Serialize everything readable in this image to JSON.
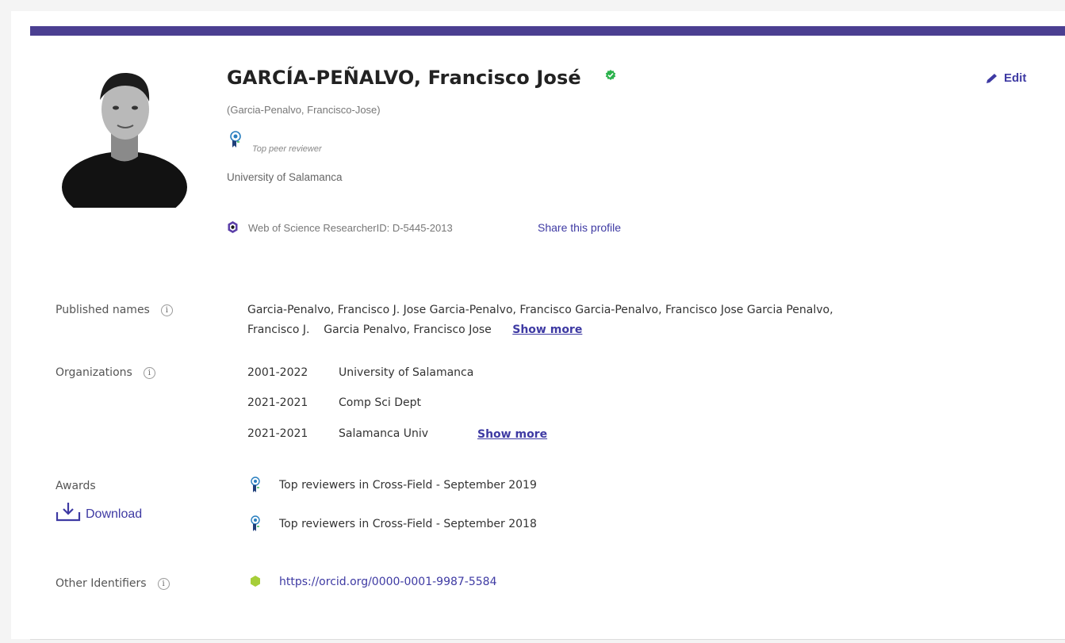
{
  "profile": {
    "name": "GARCÍA-PEÑALVO, Francisco José",
    "alt_name": "(Garcia-Penalvo, Francisco-Jose)",
    "badge_text": "Top peer reviewer",
    "affiliation": "University of Salamanca",
    "researcher_id_text": "Web of Science ResearcherID: D-5445-2013",
    "share_label": "Share this profile",
    "edit_label": "Edit"
  },
  "published_names": {
    "label": "Published names",
    "line1": "Garcia-Penalvo, Francisco J.    Jose Garcia-Penalvo, Francisco     Garcia-Penalvo, Francisco Jose     Garcia Penalvo,",
    "line2": "Francisco J.    Garcia Penalvo, Francisco Jose",
    "show_more": "Show more"
  },
  "organizations": {
    "label": "Organizations",
    "items": [
      {
        "years": "2001-2022",
        "name": "University of Salamanca"
      },
      {
        "years": "2021-2021",
        "name": "Comp Sci Dept"
      },
      {
        "years": "2021-2021",
        "name": "Salamanca Univ"
      }
    ],
    "show_more": "Show more"
  },
  "awards": {
    "label": "Awards",
    "download_label": "Download",
    "items": [
      "Top reviewers in Cross-Field - September 2019",
      "Top reviewers in Cross-Field - September 2018"
    ]
  },
  "other_identifiers": {
    "label": "Other Identifiers",
    "orcid": "https://orcid.org/0000-0001-9987-5584"
  },
  "colors": {
    "accent": "#4b3f91",
    "link": "#3e3aa3",
    "verified": "#2bb24c"
  },
  "icons": {
    "verified": "check-badge-icon",
    "reviewer": "award-ribbon-icon",
    "researcherid": "clarivate-logo-icon",
    "edit": "pencil-icon",
    "info": "info-icon",
    "download": "download-icon",
    "orcid": "orcid-hexagon-icon"
  }
}
